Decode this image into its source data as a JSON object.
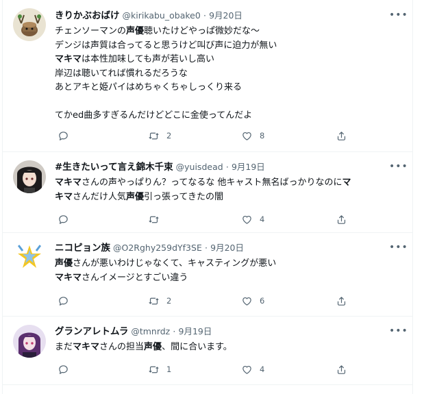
{
  "tweets": [
    {
      "name": "きりかぶおばけ",
      "handle": "@kirikabu_obake0",
      "sep": "·",
      "date": "9月20日",
      "lines": [
        [
          {
            "t": "チェンソーマンの"
          },
          {
            "t": "声優",
            "b": true
          },
          {
            "t": "聴いたけどやっぱ微妙だな〜"
          }
        ],
        [
          {
            "t": "デンジは声質は合ってると思うけど叫び声に迫力が無い"
          }
        ],
        [
          {
            "t": "マキマ",
            "b": true
          },
          {
            "t": "は本性加味しても声が若いし高い"
          }
        ],
        [
          {
            "t": "岸辺は聴いてれば慣れるだろうな"
          }
        ],
        [
          {
            "t": "あとアキと姫パイはめちゃくちゃしっくり来る"
          }
        ],
        [
          {
            "t": ""
          }
        ],
        [
          {
            "t": "てかed曲多すぎるんだけどどこに金使ってんだよ"
          }
        ]
      ],
      "reply_count": "",
      "retweet_count": "2",
      "like_count": "8"
    },
    {
      "name": "#生きたいって言え錦木千束",
      "handle": "@yuisdead",
      "sep": "·",
      "date": "9月19日",
      "lines": [
        [
          {
            "t": "マキマ",
            "b": true
          },
          {
            "t": "さんの声やっぱりん？ってなるな 他キャスト無名ばっかりなのに"
          },
          {
            "t": "マ",
            "b": true
          }
        ],
        [
          {
            "t": "キマ",
            "b": true
          },
          {
            "t": "さんだけ人気"
          },
          {
            "t": "声優",
            "b": true
          },
          {
            "t": "引っ張ってきたの闇"
          }
        ]
      ],
      "reply_count": "",
      "retweet_count": "",
      "like_count": "4"
    },
    {
      "name": "ニコピョン族",
      "handle": "@O2Rghy259dYf3SE",
      "sep": "·",
      "date": "9月20日",
      "lines": [
        [
          {
            "t": "声優",
            "b": true
          },
          {
            "t": "さんが悪いわけじゃなくて、キャスティングが悪い"
          }
        ],
        [
          {
            "t": "マキマ",
            "b": true
          },
          {
            "t": "さんイメージとすごい違う"
          }
        ]
      ],
      "reply_count": "",
      "retweet_count": "2",
      "like_count": "6"
    },
    {
      "name": "グランアレトムラ",
      "handle": "@tmnrdz",
      "sep": "·",
      "date": "9月19日",
      "lines": [
        [
          {
            "t": "まだ"
          },
          {
            "t": "マキマ",
            "b": true
          },
          {
            "t": "さんの担当"
          },
          {
            "t": "声優",
            "b": true
          },
          {
            "t": "、間に合います。"
          }
        ]
      ],
      "reply_count": "",
      "retweet_count": "1",
      "like_count": "4"
    }
  ],
  "icons": {
    "reply": "reply-icon",
    "retweet": "retweet-icon",
    "like": "heart-icon",
    "share": "share-icon",
    "more": "more-icon"
  },
  "colors": {
    "text": "#0f1419",
    "secondary": "#536471",
    "border": "#eff3f4"
  }
}
